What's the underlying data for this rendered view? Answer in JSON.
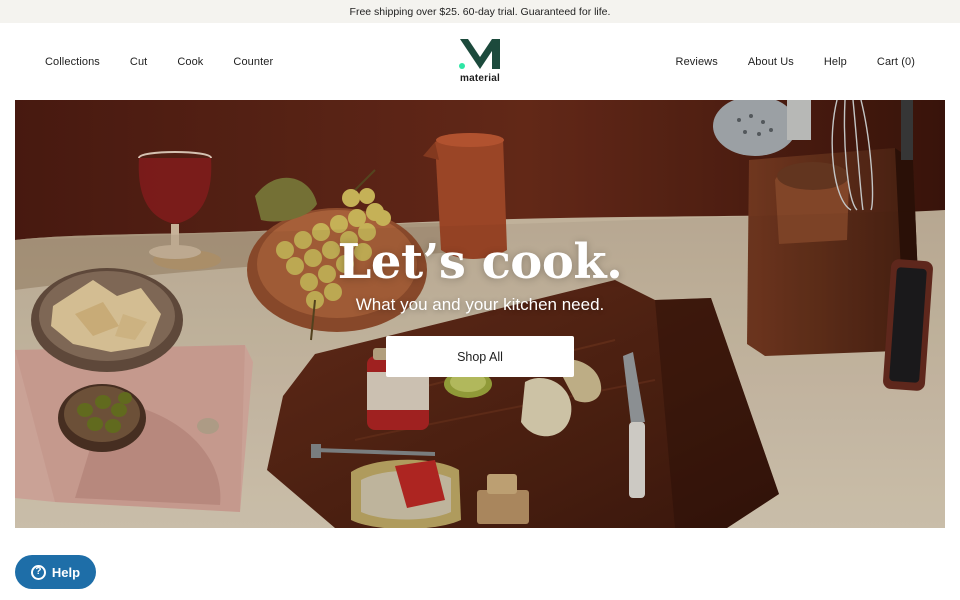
{
  "announcement": "Free shipping over $25. 60-day trial. Guaranteed for life.",
  "nav_left": [
    "Collections",
    "Cut",
    "Cook",
    "Counter"
  ],
  "nav_right": [
    "Reviews",
    "About Us",
    "Help",
    "Cart (0)"
  ],
  "logo": {
    "text": "material",
    "mark_color": "#1c4a3c",
    "dot_color": "#2ee6a5"
  },
  "hero": {
    "title": "Let’s cook.",
    "subtitle": "What you and your kitchen need.",
    "cta_label": "Shop All"
  },
  "help_widget": {
    "label": "Help",
    "icon": "question-mark-icon",
    "color": "#1e6ea8"
  }
}
